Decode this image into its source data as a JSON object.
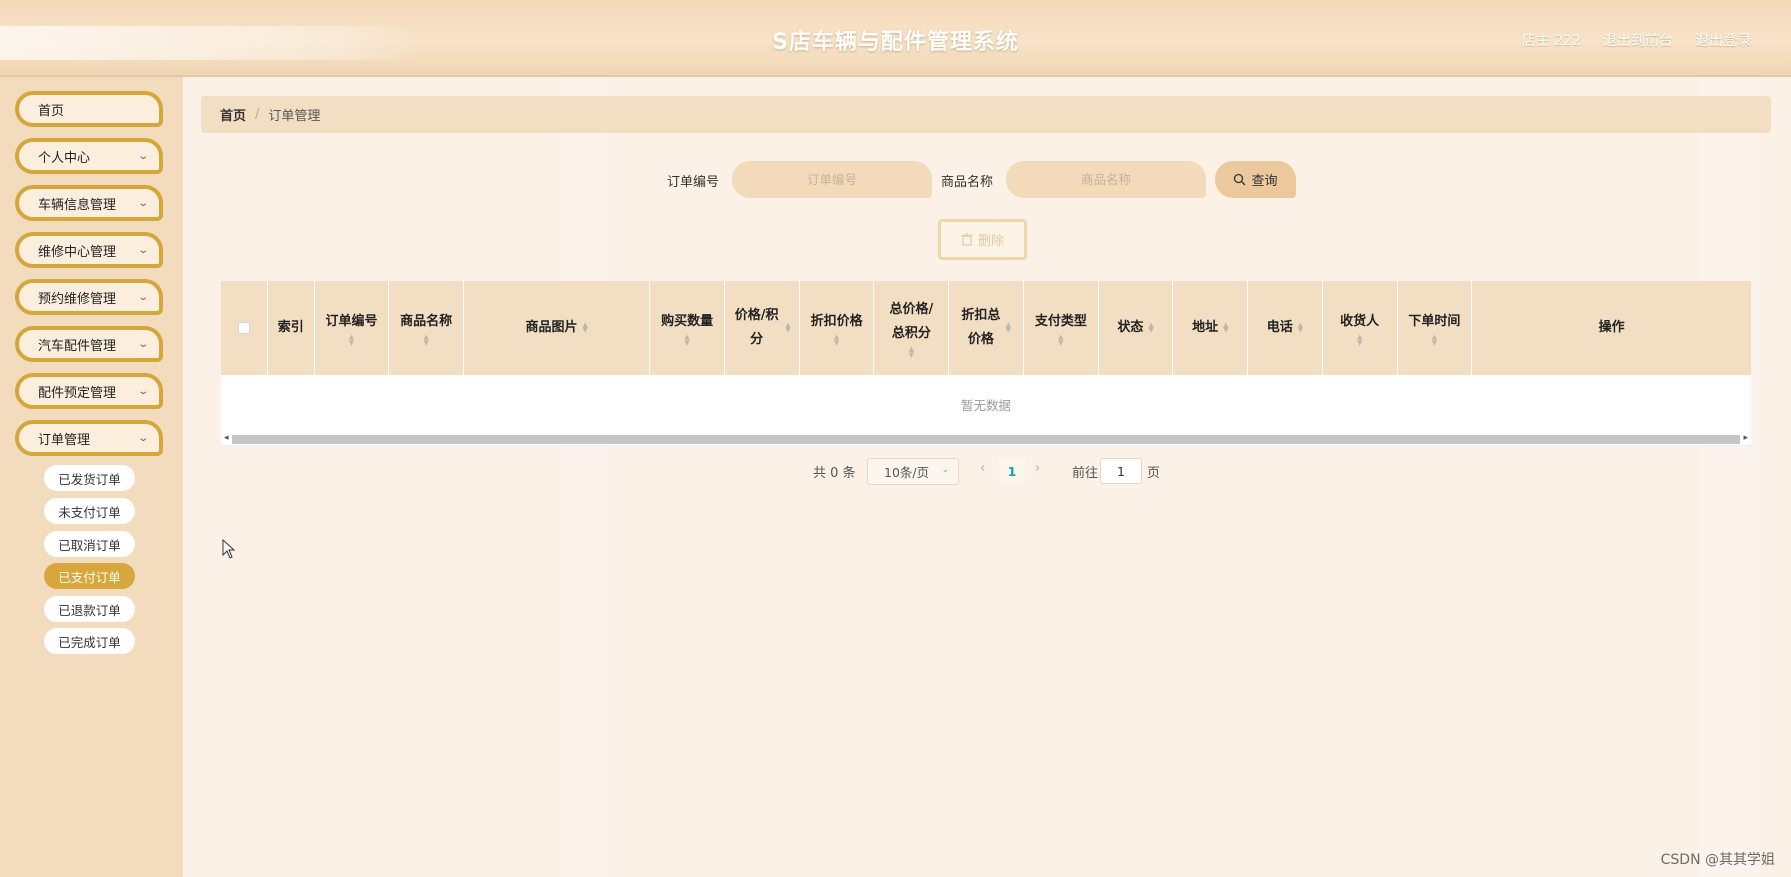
{
  "header": {
    "title": "S店车辆与配件管理系统",
    "user": "店主 222",
    "front_link": "退出到前台",
    "logout_link": "退出登录"
  },
  "sidebar": {
    "items": [
      {
        "label": "首页",
        "expandable": false
      },
      {
        "label": "个人中心",
        "expandable": true
      },
      {
        "label": "车辆信息管理",
        "expandable": true
      },
      {
        "label": "维修中心管理",
        "expandable": true
      },
      {
        "label": "预约维修管理",
        "expandable": true
      },
      {
        "label": "汽车配件管理",
        "expandable": true
      },
      {
        "label": "配件预定管理",
        "expandable": true
      },
      {
        "label": "订单管理",
        "expandable": true
      }
    ],
    "sub_items": [
      {
        "label": "已发货订单",
        "active": false
      },
      {
        "label": "未支付订单",
        "active": false
      },
      {
        "label": "已取消订单",
        "active": false
      },
      {
        "label": "已支付订单",
        "active": true
      },
      {
        "label": "已退款订单",
        "active": false
      },
      {
        "label": "已完成订单",
        "active": false
      }
    ]
  },
  "breadcrumb": {
    "home": "首页",
    "separator": "/",
    "current": "订单管理"
  },
  "search": {
    "order_no_label": "订单编号",
    "order_no_placeholder": "订单编号",
    "product_name_label": "商品名称",
    "product_name_placeholder": "商品名称",
    "query_button": "查询"
  },
  "delete_button": "删除",
  "table": {
    "columns": [
      "索引",
      "订单编号",
      "商品名称",
      "商品图片",
      "购买数量",
      "价格/积分",
      "折扣价格",
      "总价格/总积分",
      "折扣总价格",
      "支付类型",
      "状态",
      "地址",
      "电话",
      "收货人",
      "下单时间",
      "操作"
    ],
    "empty_text": "暂无数据"
  },
  "pagination": {
    "total": "共 0 条",
    "page_size": "10条/页",
    "current_page": "1",
    "goto_label": "前往",
    "goto_value": "1",
    "page_suffix": "页"
  },
  "watermark": "CSDN @其其学姐",
  "colors": {
    "accent": "#d8a73c",
    "header_bg": "#f3d9b8",
    "table_header_bg": "#f2dfc3",
    "pagination_active": "#1aa1a8"
  }
}
